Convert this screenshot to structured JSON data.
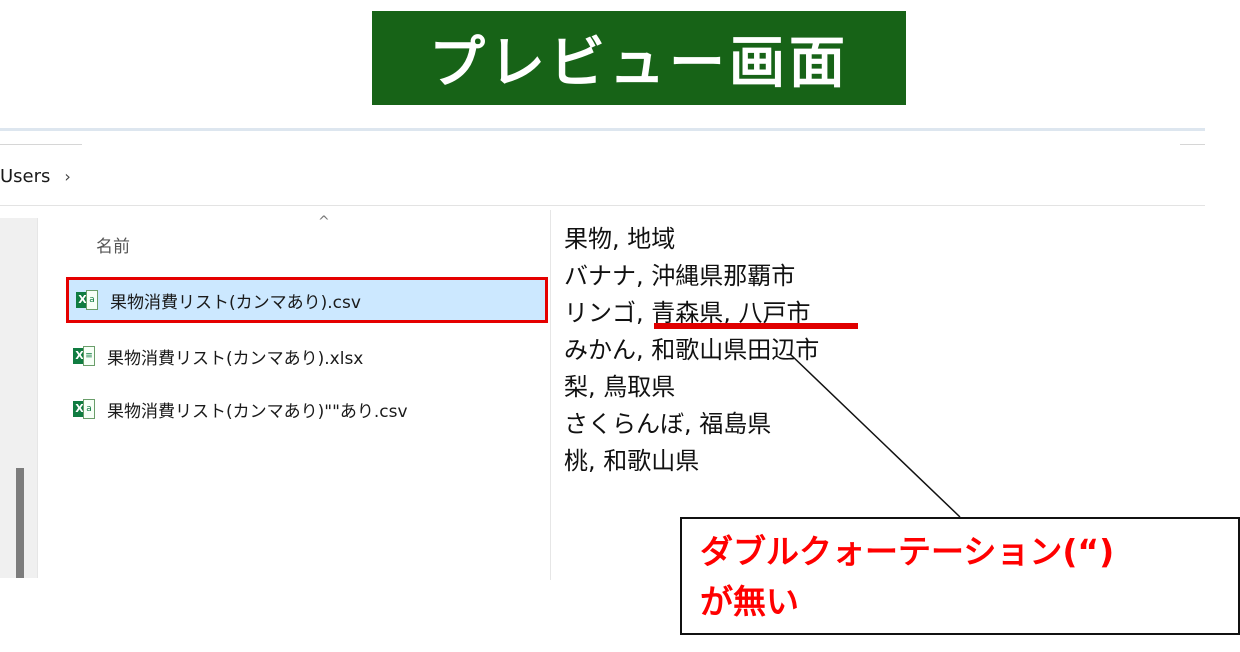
{
  "banner": {
    "title": "プレビュー画面"
  },
  "address_bar": {
    "crumb": "Users",
    "separator": "›"
  },
  "file_list": {
    "column_header": "名前",
    "sort_indicator": "^",
    "files": [
      {
        "name": "果物消費リスト(カンマあり).csv",
        "icon": "excel-csv-icon",
        "selected": true
      },
      {
        "name": "果物消費リスト(カンマあり).xlsx",
        "icon": "excel-xlsx-icon",
        "selected": false
      },
      {
        "name": "果物消費リスト(カンマあり)\"\"あり.csv",
        "icon": "excel-csv-icon",
        "selected": false
      }
    ]
  },
  "preview": {
    "lines": [
      "果物, 地域",
      "バナナ, 沖縄県那覇市",
      "リンゴ, 青森県, 八戸市",
      "みかん, 和歌山県田辺市",
      "梨, 鳥取県",
      "さくらんぼ, 福島県",
      "桃, 和歌山県"
    ]
  },
  "callout": {
    "line1": "ダブルクォーテーション(“)",
    "line2": "が無い"
  },
  "colors": {
    "banner_bg": "#176317",
    "highlight_red": "#e00000",
    "selection_bg": "#cce8ff",
    "excel_green": "#107c41"
  }
}
